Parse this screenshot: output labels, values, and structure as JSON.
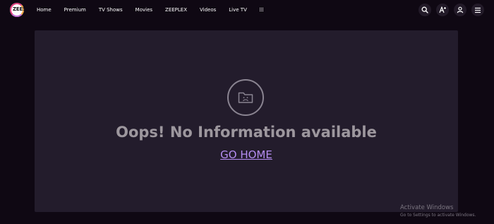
{
  "header": {
    "logo_text": "ZEE5",
    "nav": [
      "Home",
      "Premium",
      "TV Shows",
      "Movies",
      "ZEEPLEX",
      "Videos",
      "Live TV"
    ],
    "icons": [
      "grid-menu-icon",
      "search-icon",
      "language-icon",
      "user-icon",
      "hamburger-menu-icon"
    ]
  },
  "error": {
    "icon": "sad-folder-icon",
    "message": "Oops! No Information available",
    "link_label": "GO HOME"
  },
  "watermark": {
    "title": "Activate Windows",
    "subtitle": "Go to Settings to activate Windows."
  },
  "colors": {
    "background": "#0f0813",
    "panel": "#231c2c",
    "message_text": "#9d979e",
    "link": "#b58df2"
  }
}
